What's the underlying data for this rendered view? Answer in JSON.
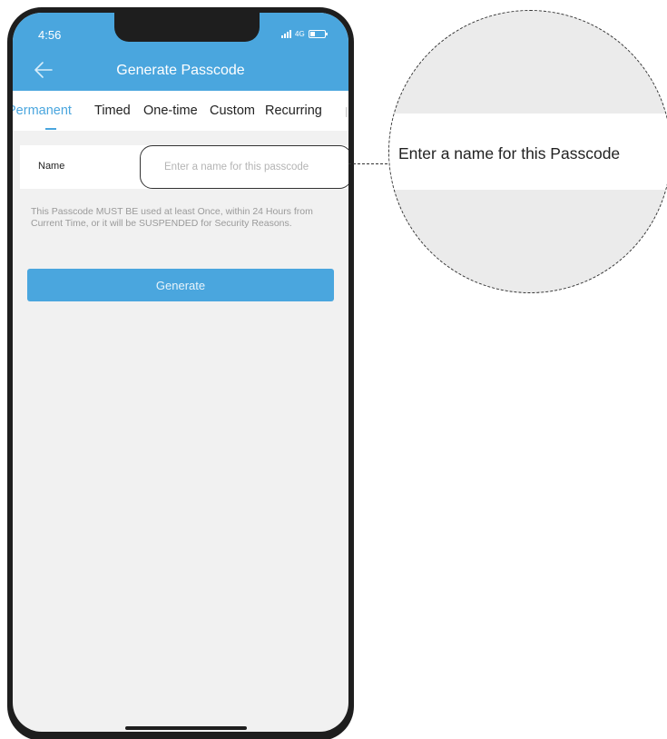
{
  "status_bar": {
    "time": "4:56",
    "network": "4G"
  },
  "header": {
    "title": "Generate Passcode",
    "back_icon": "arrow-left-icon"
  },
  "tabs": [
    {
      "label": "Permanent",
      "active": true
    },
    {
      "label": "Timed",
      "active": false
    },
    {
      "label": "One-time",
      "active": false
    },
    {
      "label": "Custom",
      "active": false
    },
    {
      "label": "Recurring",
      "active": false
    }
  ],
  "form": {
    "name_label": "Name",
    "name_value": "",
    "name_placeholder": "Enter a name for this passcode",
    "notice": "This Passcode MUST BE used at least Once, within 24 Hours from Current Time, or it will be SUSPENDED for Security Reasons.",
    "generate_label": "Generate"
  },
  "callout": {
    "text": "Enter a name for this Passcode"
  },
  "colors": {
    "accent": "#4aa6de",
    "background": "#f1f1f1",
    "phone_frame": "#1e1e1e"
  }
}
